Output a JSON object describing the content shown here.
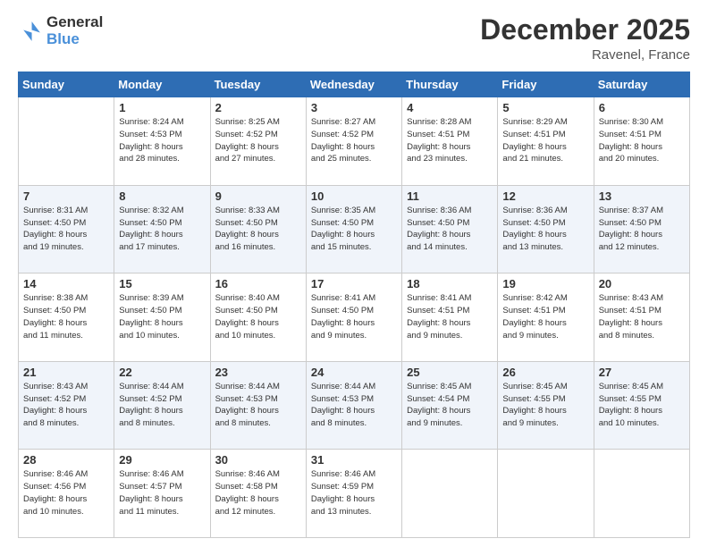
{
  "header": {
    "logo_line1": "General",
    "logo_line2": "Blue",
    "month": "December 2025",
    "location": "Ravenel, France"
  },
  "weekdays": [
    "Sunday",
    "Monday",
    "Tuesday",
    "Wednesday",
    "Thursday",
    "Friday",
    "Saturday"
  ],
  "weeks": [
    [
      {
        "day": "",
        "info": ""
      },
      {
        "day": "1",
        "info": "Sunrise: 8:24 AM\nSunset: 4:53 PM\nDaylight: 8 hours\nand 28 minutes."
      },
      {
        "day": "2",
        "info": "Sunrise: 8:25 AM\nSunset: 4:52 PM\nDaylight: 8 hours\nand 27 minutes."
      },
      {
        "day": "3",
        "info": "Sunrise: 8:27 AM\nSunset: 4:52 PM\nDaylight: 8 hours\nand 25 minutes."
      },
      {
        "day": "4",
        "info": "Sunrise: 8:28 AM\nSunset: 4:51 PM\nDaylight: 8 hours\nand 23 minutes."
      },
      {
        "day": "5",
        "info": "Sunrise: 8:29 AM\nSunset: 4:51 PM\nDaylight: 8 hours\nand 21 minutes."
      },
      {
        "day": "6",
        "info": "Sunrise: 8:30 AM\nSunset: 4:51 PM\nDaylight: 8 hours\nand 20 minutes."
      }
    ],
    [
      {
        "day": "7",
        "info": "Sunrise: 8:31 AM\nSunset: 4:50 PM\nDaylight: 8 hours\nand 19 minutes."
      },
      {
        "day": "8",
        "info": "Sunrise: 8:32 AM\nSunset: 4:50 PM\nDaylight: 8 hours\nand 17 minutes."
      },
      {
        "day": "9",
        "info": "Sunrise: 8:33 AM\nSunset: 4:50 PM\nDaylight: 8 hours\nand 16 minutes."
      },
      {
        "day": "10",
        "info": "Sunrise: 8:35 AM\nSunset: 4:50 PM\nDaylight: 8 hours\nand 15 minutes."
      },
      {
        "day": "11",
        "info": "Sunrise: 8:36 AM\nSunset: 4:50 PM\nDaylight: 8 hours\nand 14 minutes."
      },
      {
        "day": "12",
        "info": "Sunrise: 8:36 AM\nSunset: 4:50 PM\nDaylight: 8 hours\nand 13 minutes."
      },
      {
        "day": "13",
        "info": "Sunrise: 8:37 AM\nSunset: 4:50 PM\nDaylight: 8 hours\nand 12 minutes."
      }
    ],
    [
      {
        "day": "14",
        "info": "Sunrise: 8:38 AM\nSunset: 4:50 PM\nDaylight: 8 hours\nand 11 minutes."
      },
      {
        "day": "15",
        "info": "Sunrise: 8:39 AM\nSunset: 4:50 PM\nDaylight: 8 hours\nand 10 minutes."
      },
      {
        "day": "16",
        "info": "Sunrise: 8:40 AM\nSunset: 4:50 PM\nDaylight: 8 hours\nand 10 minutes."
      },
      {
        "day": "17",
        "info": "Sunrise: 8:41 AM\nSunset: 4:50 PM\nDaylight: 8 hours\nand 9 minutes."
      },
      {
        "day": "18",
        "info": "Sunrise: 8:41 AM\nSunset: 4:51 PM\nDaylight: 8 hours\nand 9 minutes."
      },
      {
        "day": "19",
        "info": "Sunrise: 8:42 AM\nSunset: 4:51 PM\nDaylight: 8 hours\nand 9 minutes."
      },
      {
        "day": "20",
        "info": "Sunrise: 8:43 AM\nSunset: 4:51 PM\nDaylight: 8 hours\nand 8 minutes."
      }
    ],
    [
      {
        "day": "21",
        "info": "Sunrise: 8:43 AM\nSunset: 4:52 PM\nDaylight: 8 hours\nand 8 minutes."
      },
      {
        "day": "22",
        "info": "Sunrise: 8:44 AM\nSunset: 4:52 PM\nDaylight: 8 hours\nand 8 minutes."
      },
      {
        "day": "23",
        "info": "Sunrise: 8:44 AM\nSunset: 4:53 PM\nDaylight: 8 hours\nand 8 minutes."
      },
      {
        "day": "24",
        "info": "Sunrise: 8:44 AM\nSunset: 4:53 PM\nDaylight: 8 hours\nand 8 minutes."
      },
      {
        "day": "25",
        "info": "Sunrise: 8:45 AM\nSunset: 4:54 PM\nDaylight: 8 hours\nand 9 minutes."
      },
      {
        "day": "26",
        "info": "Sunrise: 8:45 AM\nSunset: 4:55 PM\nDaylight: 8 hours\nand 9 minutes."
      },
      {
        "day": "27",
        "info": "Sunrise: 8:45 AM\nSunset: 4:55 PM\nDaylight: 8 hours\nand 10 minutes."
      }
    ],
    [
      {
        "day": "28",
        "info": "Sunrise: 8:46 AM\nSunset: 4:56 PM\nDaylight: 8 hours\nand 10 minutes."
      },
      {
        "day": "29",
        "info": "Sunrise: 8:46 AM\nSunset: 4:57 PM\nDaylight: 8 hours\nand 11 minutes."
      },
      {
        "day": "30",
        "info": "Sunrise: 8:46 AM\nSunset: 4:58 PM\nDaylight: 8 hours\nand 12 minutes."
      },
      {
        "day": "31",
        "info": "Sunrise: 8:46 AM\nSunset: 4:59 PM\nDaylight: 8 hours\nand 13 minutes."
      },
      {
        "day": "",
        "info": ""
      },
      {
        "day": "",
        "info": ""
      },
      {
        "day": "",
        "info": ""
      }
    ]
  ]
}
